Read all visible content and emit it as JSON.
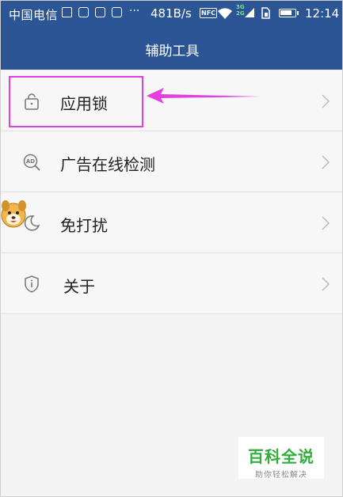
{
  "status_bar": {
    "carrier": "中国电信",
    "overflow": "···",
    "speed": "481B/s",
    "nfc": "NFC",
    "network_top": "3G",
    "network_bottom": "2G",
    "time": "12:14"
  },
  "app_bar": {
    "title": "辅助工具"
  },
  "menu": {
    "items": [
      {
        "label": "应用锁",
        "icon": "lock-icon"
      },
      {
        "label": "广告在线检测",
        "icon": "ad-detect-icon"
      },
      {
        "label": "免打扰",
        "icon": "moon-icon"
      },
      {
        "label": "关于",
        "icon": "shield-info-icon"
      }
    ]
  },
  "watermark": {
    "main": "百科全说",
    "sub": "助你轻松解决"
  },
  "colors": {
    "app_bar": "#2b5595",
    "highlight": "#e23ee0",
    "watermark_green": "#2fae3a"
  }
}
